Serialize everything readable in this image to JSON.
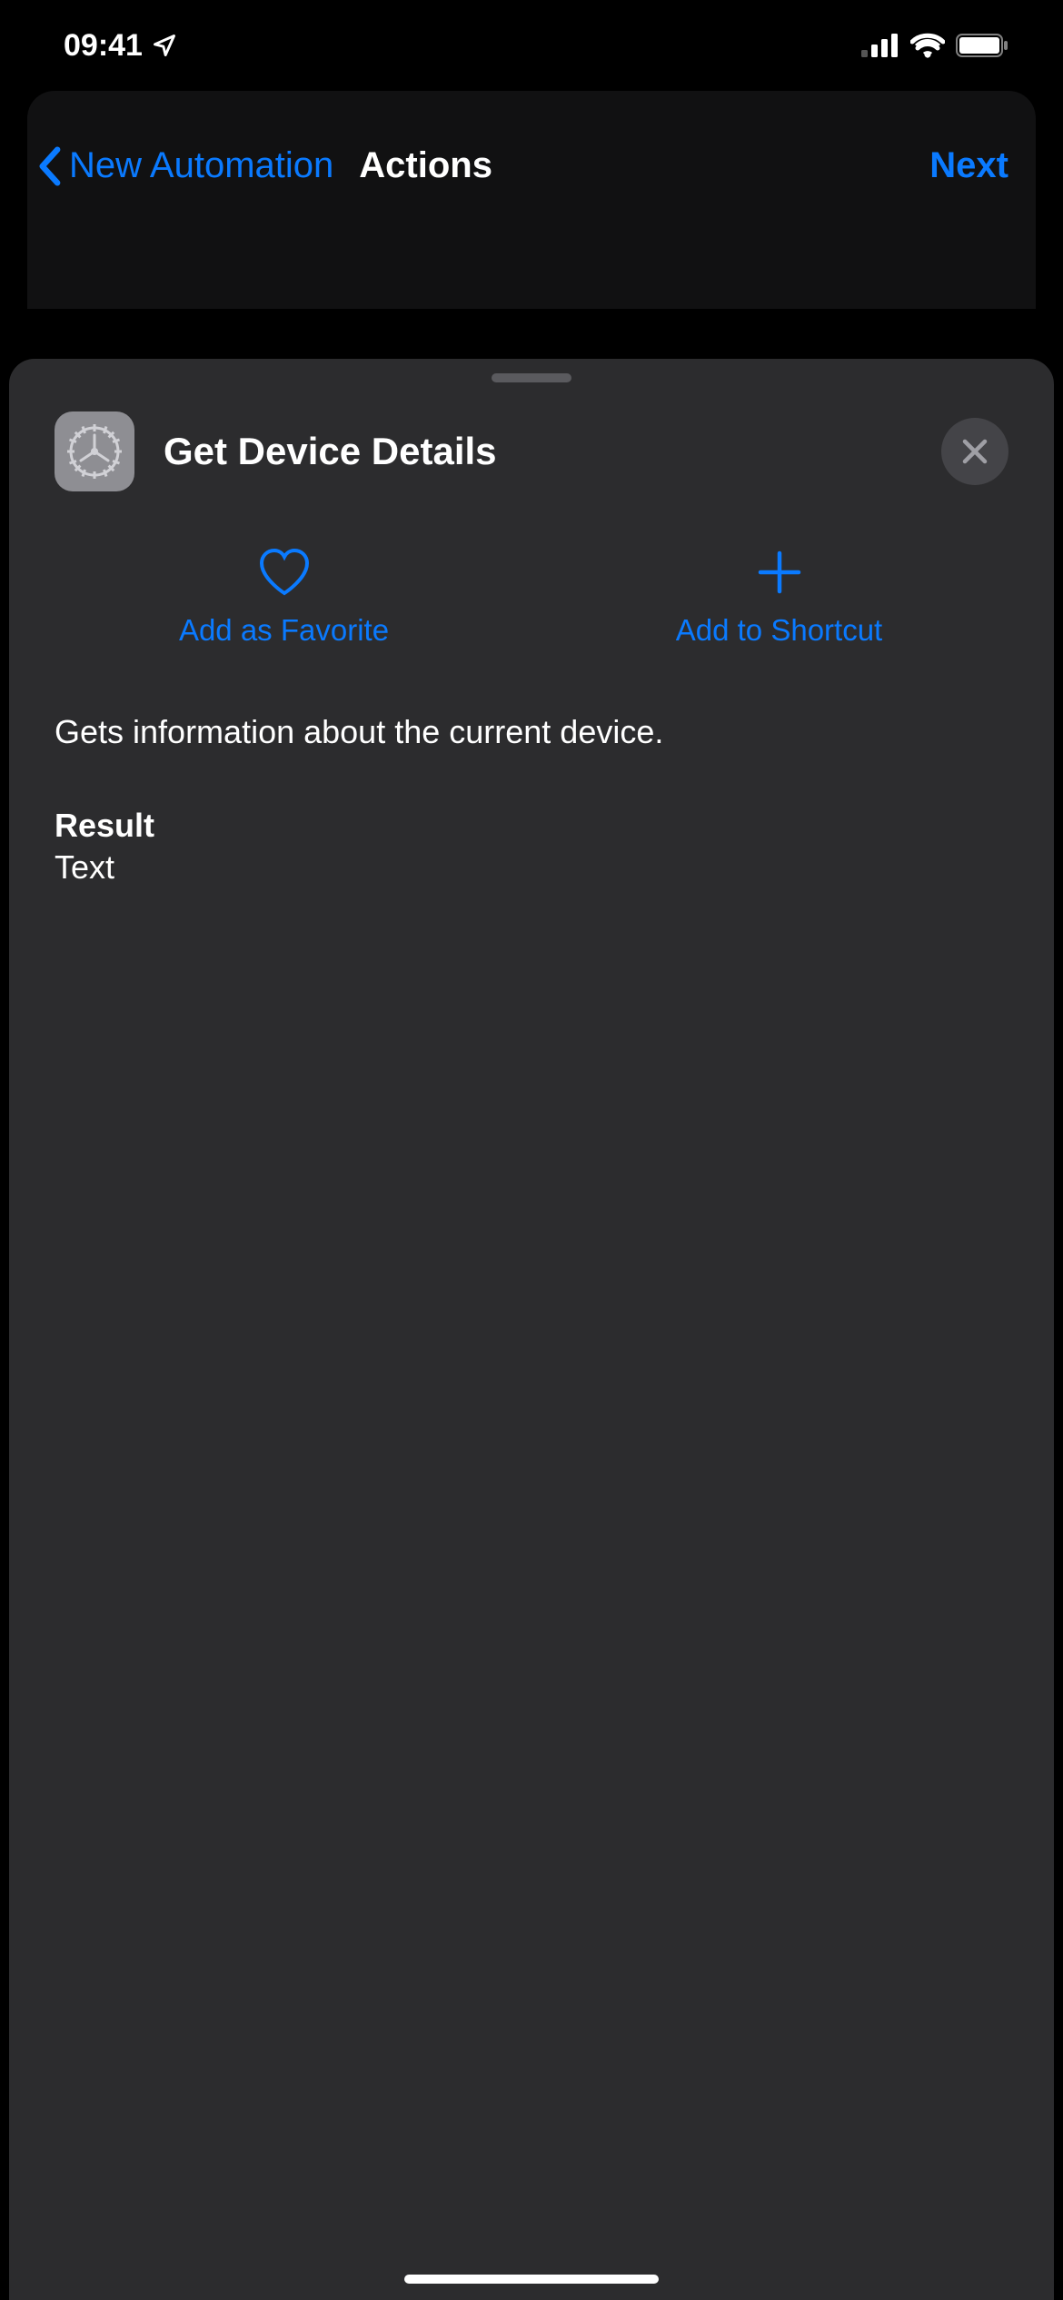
{
  "statusBar": {
    "time": "09:41"
  },
  "nav": {
    "back_label": "New Automation",
    "title": "Actions",
    "next_label": "Next"
  },
  "sheet": {
    "title": "Get Device Details",
    "favorite_label": "Add as Favorite",
    "shortcut_label": "Add to Shortcut",
    "description": "Gets information about the current device.",
    "result_heading": "Result",
    "result_value": "Text"
  }
}
